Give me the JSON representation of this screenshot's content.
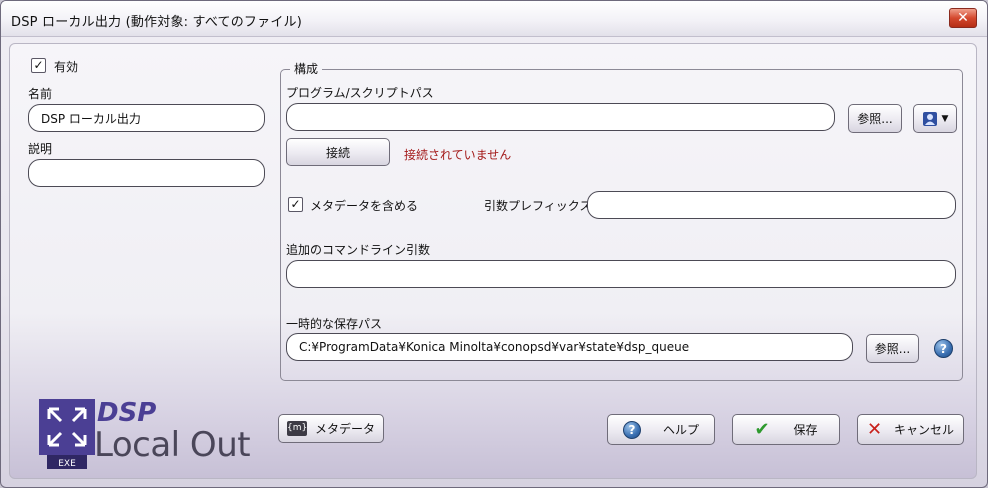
{
  "window": {
    "title": "DSP ローカル出力   (動作対象: すべてのファイル)",
    "close_label": "✕"
  },
  "left": {
    "enabled_label": "有効",
    "enabled_check": "✓",
    "name_label": "名前",
    "name_value": "DSP ローカル出力",
    "description_label": "説明",
    "description_value": ""
  },
  "config": {
    "legend": "構成",
    "program_path_label": "プログラム/スクリプトパス",
    "program_path_value": "",
    "browse_label": "参照...",
    "connect_label": "接続",
    "status_text": "接続されていません",
    "include_metadata_label": "メタデータを含める",
    "include_metadata_check": "✓",
    "arg_prefix_label": "引数プレフィックス",
    "arg_prefix_value": "",
    "extra_args_label": "追加のコマンドライン引数",
    "extra_args_value": "",
    "temp_path_label": "一時的な保存パス",
    "temp_path_value": "C:¥ProgramData¥Konica Minolta¥conopsd¥var¥state¥dsp_queue",
    "temp_browse_label": "参照...",
    "help_glyph": "?"
  },
  "footer": {
    "logo_top": "DSP",
    "logo_bottom": "Local Out",
    "logo_exe": "EXE",
    "metadata_label": "メタデータ",
    "metadata_icon_text": "{m}",
    "help_label": "ヘルプ",
    "save_label": "保存",
    "cancel_label": "キャンセル"
  },
  "colors": {
    "accent": "#4b3f94",
    "status_error": "#a31818",
    "save_check": "#2e9a2e",
    "cancel_x": "#c8201a"
  }
}
